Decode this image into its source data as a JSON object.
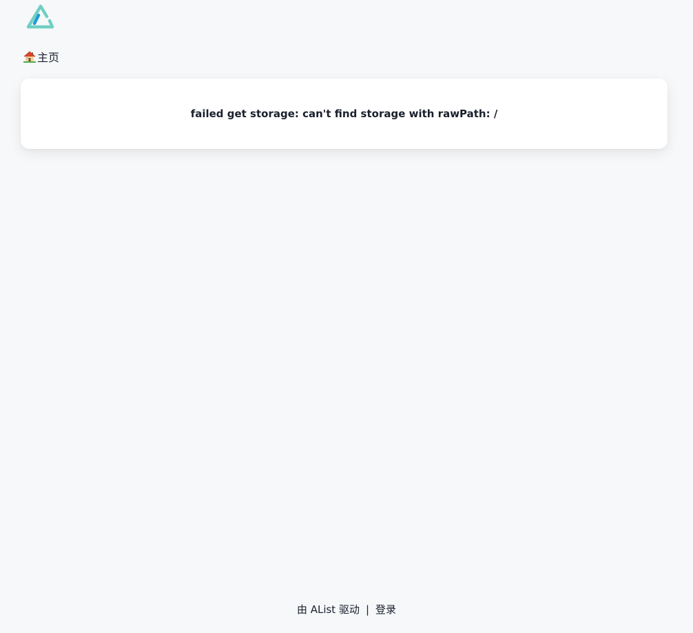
{
  "header": {
    "logo_icon": "alist-logo-icon",
    "colors": {
      "teal": "#70cfc3",
      "blue": "#1f9bd8"
    }
  },
  "breadcrumb": {
    "home_icon": "house-emoji-icon",
    "home_label": "主页"
  },
  "message": {
    "text": "failed get storage: can't find storage with rawPath: /"
  },
  "footer": {
    "powered_by": "由 AList 驱动",
    "separator": "|",
    "login_label": "登录"
  }
}
